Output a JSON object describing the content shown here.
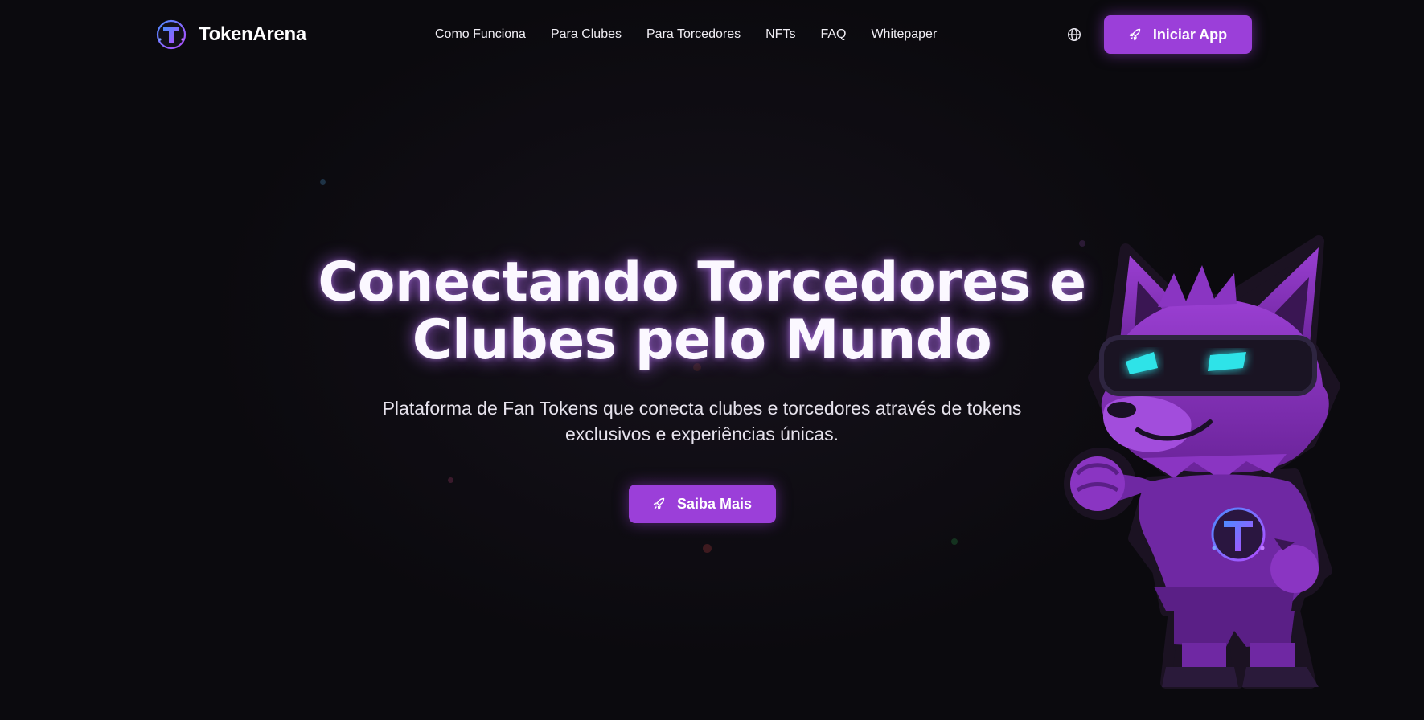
{
  "brand": {
    "name": "TokenArena",
    "logo_letter": "T",
    "accent": "#9b3fd9"
  },
  "nav": {
    "items": [
      {
        "label": "Como Funciona"
      },
      {
        "label": "Para Clubes"
      },
      {
        "label": "Para Torcedores"
      },
      {
        "label": "NFTs"
      },
      {
        "label": "FAQ"
      },
      {
        "label": "Whitepaper"
      }
    ],
    "language_icon": "globe-icon",
    "cta_label": "Iniciar App",
    "cta_icon": "rocket-icon"
  },
  "hero": {
    "title_line1": "Conectando Torcedores e",
    "title_line2": "Clubes pelo Mundo",
    "subtitle_line1": "Plataforma de Fan Tokens que conecta clubes e torcedores através de tokens",
    "subtitle_line2": "exclusivos e experiências únicas.",
    "cta_label": "Saiba Mais",
    "cta_icon": "rocket-icon",
    "mascot": "wolf-mascot-illustration",
    "mascot_shirt_letter": "T"
  },
  "colors": {
    "background": "#0b0a0e",
    "button": "#9b3fd9",
    "mascot_purple": "#7d2fb5",
    "mascot_eyes": "#2fe3e8"
  }
}
